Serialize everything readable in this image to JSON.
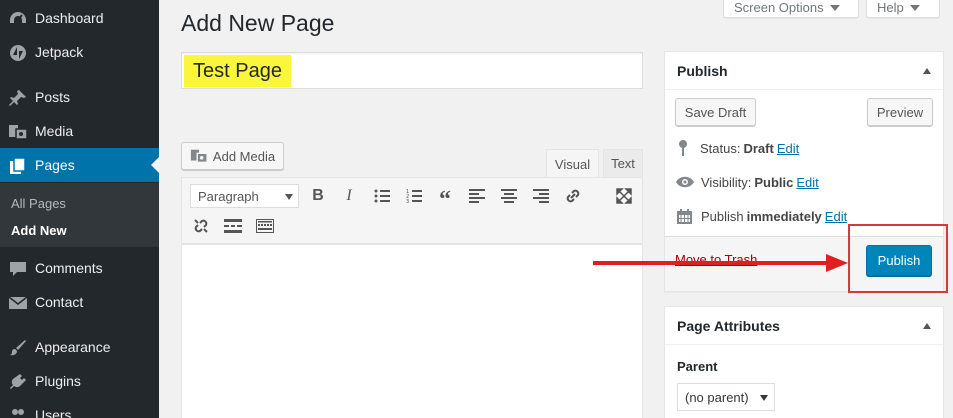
{
  "sidebar": {
    "items": [
      {
        "label": "Dashboard",
        "icon": "dashboard-icon"
      },
      {
        "label": "Jetpack",
        "icon": "jetpack-icon"
      },
      {
        "label": "Posts",
        "icon": "pin-icon"
      },
      {
        "label": "Media",
        "icon": "media-icon"
      },
      {
        "label": "Pages",
        "icon": "pages-icon"
      },
      {
        "label": "Comments",
        "icon": "comments-icon"
      },
      {
        "label": "Contact",
        "icon": "envelope-icon"
      },
      {
        "label": "Appearance",
        "icon": "paintbrush-icon"
      },
      {
        "label": "Plugins",
        "icon": "plugin-icon"
      },
      {
        "label": "Users",
        "icon": "users-icon"
      }
    ],
    "submenu": [
      {
        "label": "All Pages"
      },
      {
        "label": "Add New"
      }
    ]
  },
  "header": {
    "title": "Add New Page",
    "screen_options_label": "Screen Options",
    "help_label": "Help"
  },
  "editor": {
    "title_value": "Test Page",
    "add_media_label": "Add Media",
    "tabs": [
      {
        "label": "Visual"
      },
      {
        "label": "Text"
      }
    ],
    "format_select_value": "Paragraph"
  },
  "publish_box": {
    "heading": "Publish",
    "save_draft_label": "Save Draft",
    "preview_label": "Preview",
    "status_label": "Status:",
    "status_value": "Draft",
    "visibility_label": "Visibility:",
    "visibility_value": "Public",
    "schedule_label": "Publish",
    "schedule_value": "immediately",
    "edit_label": "Edit",
    "trash_label": "Move to Trash",
    "publish_label": "Publish"
  },
  "attributes_box": {
    "heading": "Page Attributes",
    "parent_label": "Parent",
    "parent_value": "(no parent)"
  },
  "colors": {
    "sidebar_bg": "#23282d",
    "active_menu": "#0073aa",
    "publish_button": "#0085ba",
    "title_highlight": "#faf63c",
    "annotation_red": "#d9383b"
  }
}
